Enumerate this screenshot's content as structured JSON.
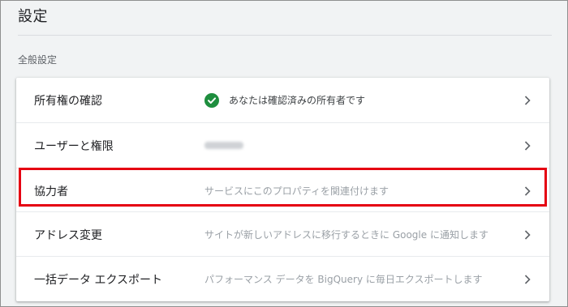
{
  "page": {
    "title": "設定",
    "section_label": "全般設定"
  },
  "settings": {
    "rows": [
      {
        "label": "所有権の確認",
        "value": "あなたは確認済みの所有者です",
        "icon": "check-circle-icon",
        "status_color": "#1e8e3e"
      },
      {
        "label": "ユーザーと権限",
        "value": ""
      },
      {
        "label": "協力者",
        "value": "サービスにこのプロパティを関連付けます",
        "highlighted": true
      },
      {
        "label": "アドレス変更",
        "value": "サイトが新しいアドレスに移行するときに Google に通知します"
      },
      {
        "label": "一括データ エクスポート",
        "value": "パフォーマンス データを BigQuery に毎日エクスポートします"
      }
    ]
  },
  "annotation": {
    "highlight_color": "#e50012"
  }
}
